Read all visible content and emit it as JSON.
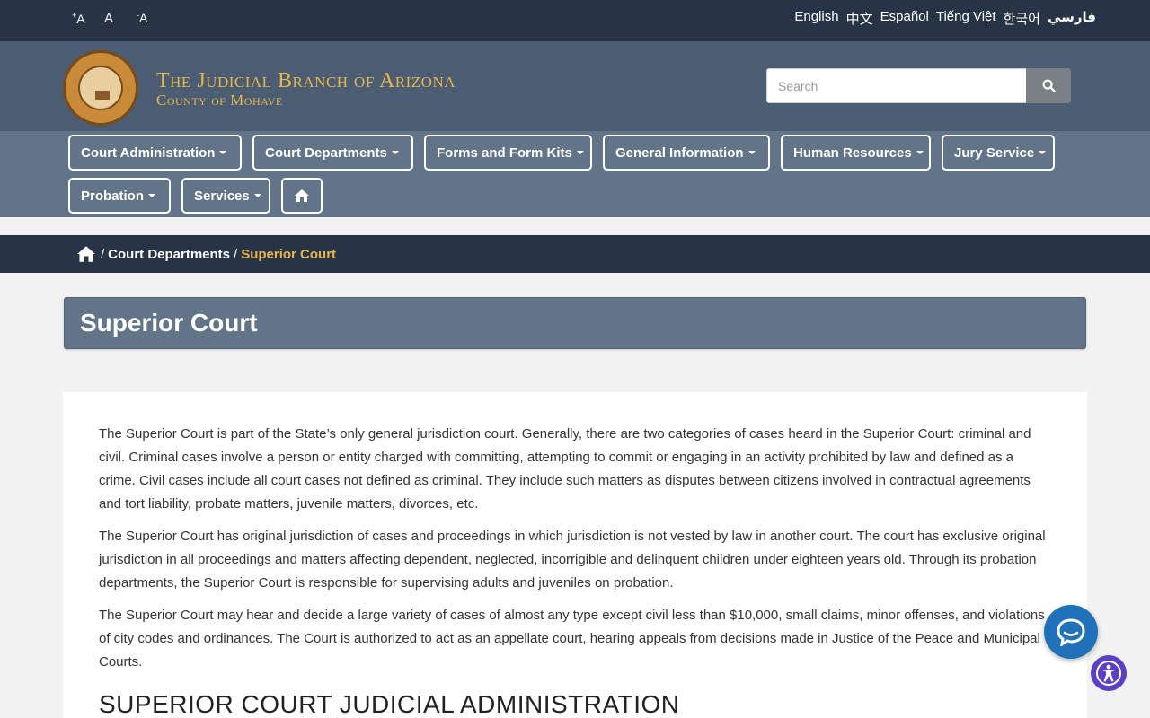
{
  "topbar": {
    "font_controls": [
      {
        "label": "A",
        "prefix": "+",
        "icon": "increase-font-icon"
      },
      {
        "label": "A",
        "prefix": "",
        "icon": "reset-font-icon"
      },
      {
        "label": "A",
        "prefix": "-",
        "icon": "decrease-font-icon"
      }
    ],
    "languages": [
      "English",
      "中文",
      "Español",
      "Tiếng Việt",
      "한국어",
      "فارسي"
    ]
  },
  "header": {
    "title": "The Judicial Branch of Arizona",
    "subtitle": "County of Mohave",
    "logo_icon": "arizona-state-seal-icon",
    "search_placeholder": "Search",
    "search_icon": "search-icon"
  },
  "nav": {
    "items": [
      "Court Administration",
      "Court Departments",
      "Forms and Form Kits",
      "General Information",
      "Human Resources",
      "Jury Service",
      "Probation",
      "Services"
    ],
    "home_icon": "home-icon"
  },
  "breadcrumb": {
    "home_icon": "home-icon",
    "sep": "/",
    "parent": "Court Departments",
    "current": "Superior Court"
  },
  "page": {
    "title": "Superior Court",
    "paragraphs": [
      "The Superior Court is part of the State’s only general jurisdiction court.  Generally, there are two categories of cases heard in the Superior Court: criminal and civil.  Criminal cases involve a person or entity charged with committing, attempting to commit or engaging in an activity prohibited by law and defined as a crime.  Civil cases include all court cases not defined as criminal.  They include such matters as disputes between citizens involved in contractual agreements and tort liability, probate matters, juvenile matters, divorces, etc.",
      "The Superior Court has original jurisdiction of cases and proceedings in which jurisdiction is not vested by law in another court.  The court has exclusive original jurisdiction in all proceedings and matters affecting dependent, neglected, incorrigible and delinquent children under eighteen years old.  Through its probation departments, the Superior Court is responsible for supervising adults and juveniles on probation.",
      "The Superior Court may hear and decide a large variety of cases of almost any type except civil less than $10,000, small claims, minor offenses, and violations of city codes and ordinances.  The Court is authorized to act as an appellate court, hearing appeals from decisions made in Justice of the Peace and Municipal Courts."
    ],
    "section_heading": "SUPERIOR COURT JUDICIAL ADMINISTRATION"
  },
  "floating": {
    "chat_icon": "chat-bubble-icon",
    "accessibility_icon": "accessibility-icon"
  },
  "colors": {
    "topbar": "#263445",
    "header": "#4a5d73",
    "nav": "#627487",
    "accent_gold": "#e9b44c",
    "chat_blue": "#1f72b8",
    "access_purple": "#5b3fc4"
  }
}
